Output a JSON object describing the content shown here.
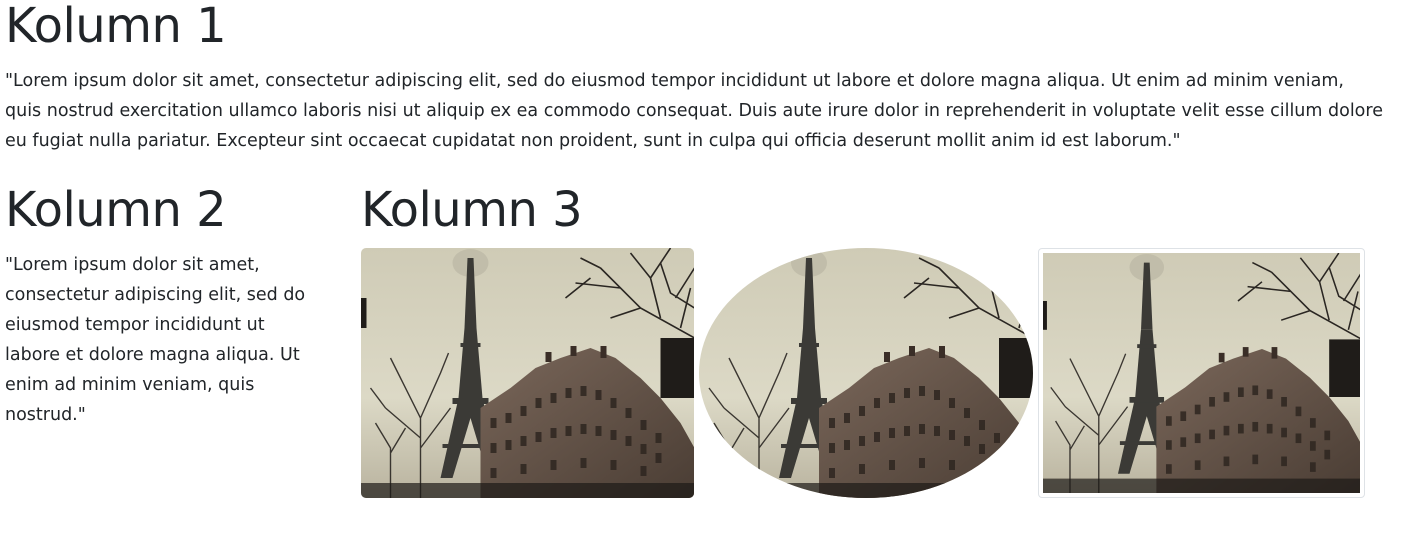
{
  "columns": [
    {
      "heading": "Kolumn 1",
      "text": "\"Lorem ipsum dolor sit amet, consectetur adipiscing elit, sed do eiusmod tempor incididunt ut labore et dolore magna aliqua. Ut enim ad minim veniam, quis nostrud exercitation ullamco laboris nisi ut aliquip ex ea commodo consequat. Duis aute irure dolor in reprehenderit in voluptate velit esse cillum dolore eu fugiat nulla pariatur. Excepteur sint occaecat cupidatat non proident, sunt in culpa qui officia deserunt mollit anim id est laborum.\""
    },
    {
      "heading": "Kolumn 2",
      "text": "\"Lorem ipsum dolor sit amet, consectetur adipiscing elit, sed do eiusmod tempor incididunt ut labore et dolore magna aliqua. Ut enim ad minim veniam, quis nostrud.\""
    },
    {
      "heading": "Kolumn 3",
      "images": [
        {
          "subject": "eiffel-tower-street-photo",
          "style": "rounded"
        },
        {
          "subject": "eiffel-tower-street-photo",
          "style": "circle"
        },
        {
          "subject": "eiffel-tower-street-photo",
          "style": "thumbnail"
        }
      ]
    }
  ],
  "colors": {
    "text": "#212529",
    "thumbnail_border": "#dee2e6",
    "sky": "#d9d6c3",
    "tower": "#3b3a36",
    "building": "#6b5a4e",
    "tree": "#2a2622"
  }
}
